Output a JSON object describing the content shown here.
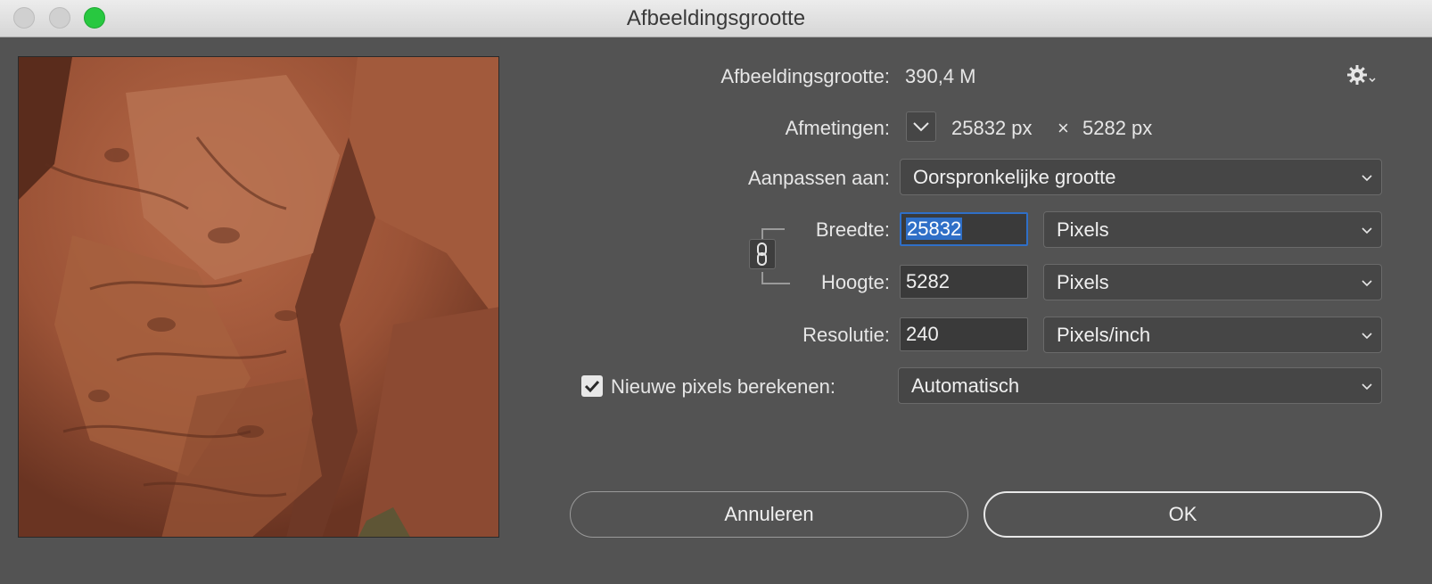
{
  "window": {
    "title": "Afbeeldingsgrootte"
  },
  "image_size": {
    "label": "Afbeeldingsgrootte:",
    "value": "390,4 M"
  },
  "dimensions": {
    "label": "Afmetingen:",
    "width": "25832 px",
    "times": "×",
    "height": "5282 px"
  },
  "fit_to": {
    "label": "Aanpassen aan:",
    "value": "Oorspronkelijke grootte"
  },
  "width": {
    "label": "Breedte:",
    "value": "25832",
    "unit": "Pixels"
  },
  "height": {
    "label": "Hoogte:",
    "value": "5282",
    "unit": "Pixels"
  },
  "resolution": {
    "label": "Resolutie:",
    "value": "240",
    "unit": "Pixels/inch"
  },
  "resample": {
    "label": "Nieuwe pixels berekenen:",
    "checked": true,
    "value": "Automatisch"
  },
  "buttons": {
    "cancel": "Annuleren",
    "ok": "OK"
  },
  "icons": {
    "settings": "gear-icon",
    "link": "chain-link-icon",
    "dimensions_toggle": "chevron-down-icon"
  },
  "colors": {
    "accent": "#2f6fc7",
    "close_button": "#28c840",
    "background": "#535353"
  }
}
